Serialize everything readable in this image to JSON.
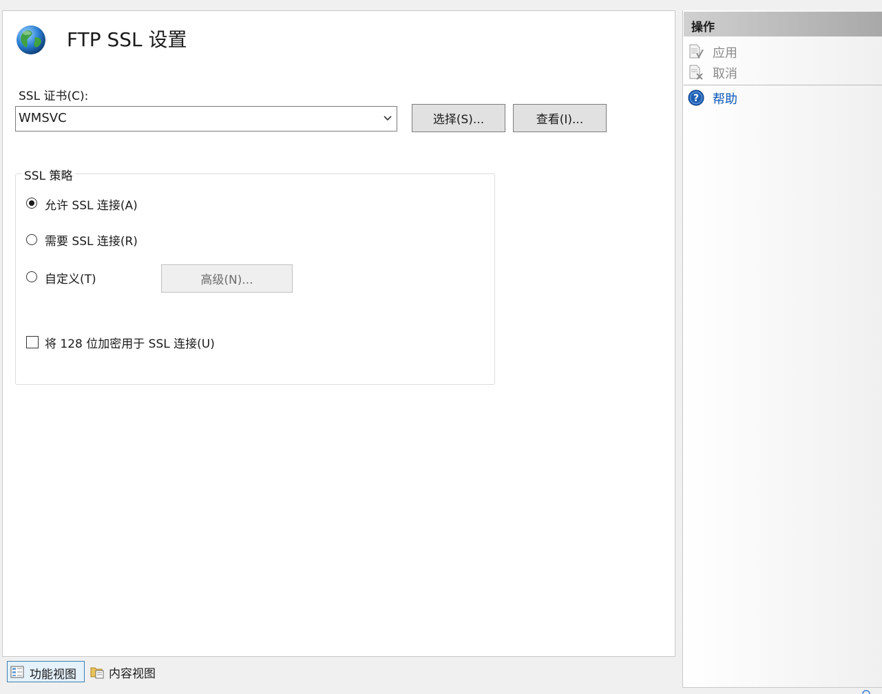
{
  "main": {
    "title": "FTP SSL 设置",
    "cert_label": "SSL 证书(C):",
    "cert_value": "WMSVC",
    "select_button": "选择(S)...",
    "view_button": "查看(I)...",
    "policy": {
      "legend": "SSL 策略",
      "allow_label": "允许 SSL 连接(A)",
      "require_label": "需要 SSL 连接(R)",
      "custom_label": "自定义(T)",
      "selected": "allow",
      "advanced_button": "高级(N)...",
      "use_128_label": "将 128 位加密用于 SSL 连接(U)",
      "use_128_checked": false
    }
  },
  "view_bar": {
    "feature_view": "功能视图",
    "content_view": "内容视图",
    "active": "feature_view"
  },
  "actions": {
    "title": "操作",
    "items": [
      {
        "label": "应用",
        "icon": "apply-icon",
        "enabled": false
      },
      {
        "label": "取消",
        "icon": "cancel-icon",
        "enabled": false
      },
      {
        "label": "帮助",
        "icon": "help-icon",
        "enabled": true
      }
    ]
  },
  "colors": {
    "accent": "#0a56b8",
    "panel_bg": "#ffffff",
    "window_bg": "#f0f0f0",
    "actions_header": "#a8a8a8"
  }
}
